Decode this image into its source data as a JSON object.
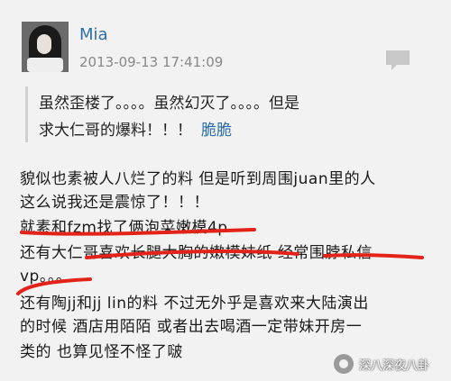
{
  "post": {
    "username": "Mia",
    "timestamp": "2013-09-13 17:41:09",
    "quote": {
      "line1": "虽然歪楼了。。。。虽然幻灭了。。。。但是",
      "line2": "求大仁哥的爆料！！！",
      "mention": "脆脆"
    },
    "body": [
      "貌似也素被人八烂了的料 但是听到周围juan里的人",
      "这么说我还是震惊了！！！",
      "就素和fzm找了俩泡菜嫩模4p",
      "还有大仁哥喜欢长腿大胸的嫩模妹纸 经常围脖私信",
      "vp。。。",
      "还有陶jj和jj lin的料 不过无外乎是喜欢来大陆演出",
      "的时候 酒店用陌陌 或者出去喝酒一定带妹开房一",
      "类的 也算见怪不怪了啵"
    ]
  },
  "watermark": {
    "text": "深八深夜八卦"
  },
  "icons": {
    "comment": "comment-bubble-icon",
    "avatar": "avatar"
  },
  "colors": {
    "link": "#2d6ea8",
    "underline": "#e3221a",
    "background": "#f2f2f2"
  }
}
